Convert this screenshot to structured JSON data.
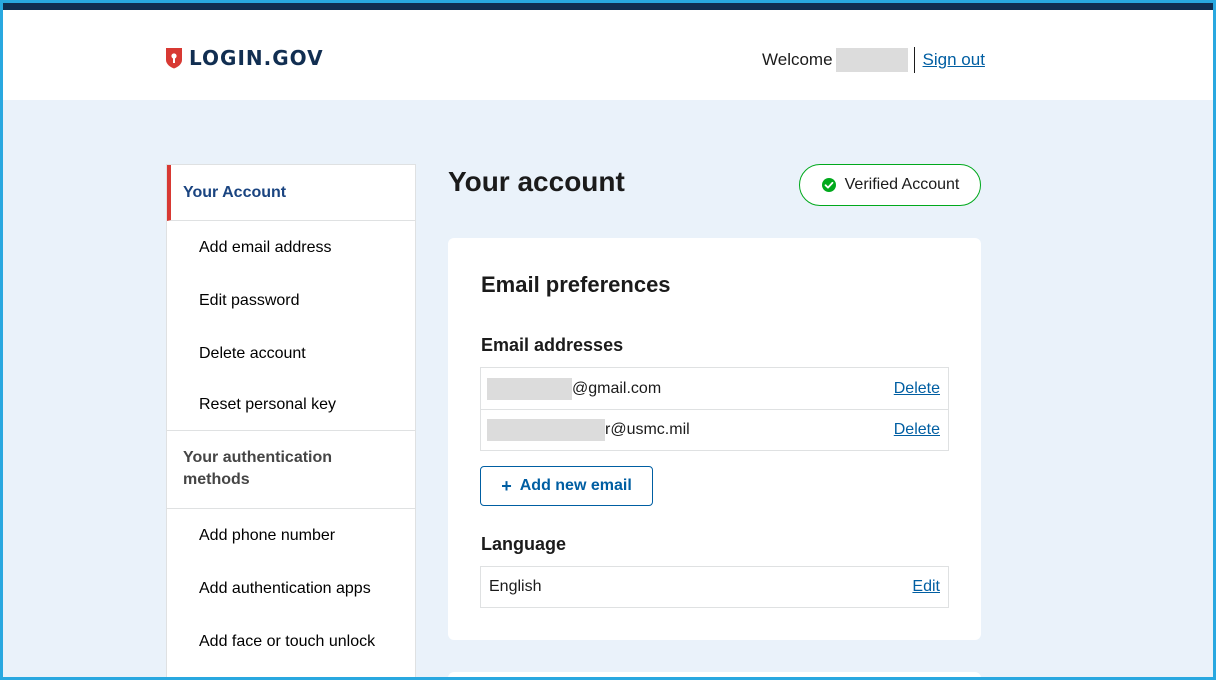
{
  "header": {
    "logo_text": "LOGIN.GOV",
    "welcome_label": "Welcome",
    "sign_out_label": "Sign out"
  },
  "sidebar": {
    "sections": [
      {
        "label": "Your Account",
        "items": [
          "Add email address",
          "Edit password",
          "Delete account",
          "Reset personal key"
        ]
      },
      {
        "label": "Your authentication methods",
        "items": [
          "Add phone number",
          "Add authentication apps",
          "Add face or touch unlock"
        ]
      }
    ]
  },
  "main": {
    "title": "Your account",
    "badge": "Verified Account",
    "card": {
      "title": "Email preferences",
      "emails_label": "Email addresses",
      "emails": [
        {
          "suffix": "@gmail.com",
          "action": "Delete"
        },
        {
          "suffix": "r@usmc.mil",
          "action": "Delete"
        }
      ],
      "add_email_label": "Add new email",
      "add_email_icon": "+",
      "language_label": "Language",
      "language_value": "English",
      "language_action": "Edit"
    }
  },
  "colors": {
    "brand_navy": "#112e51",
    "link_blue": "#005ea2",
    "accent_red": "#d83933",
    "verified_green": "#00a91c",
    "page_bg": "#eaf2fa"
  }
}
